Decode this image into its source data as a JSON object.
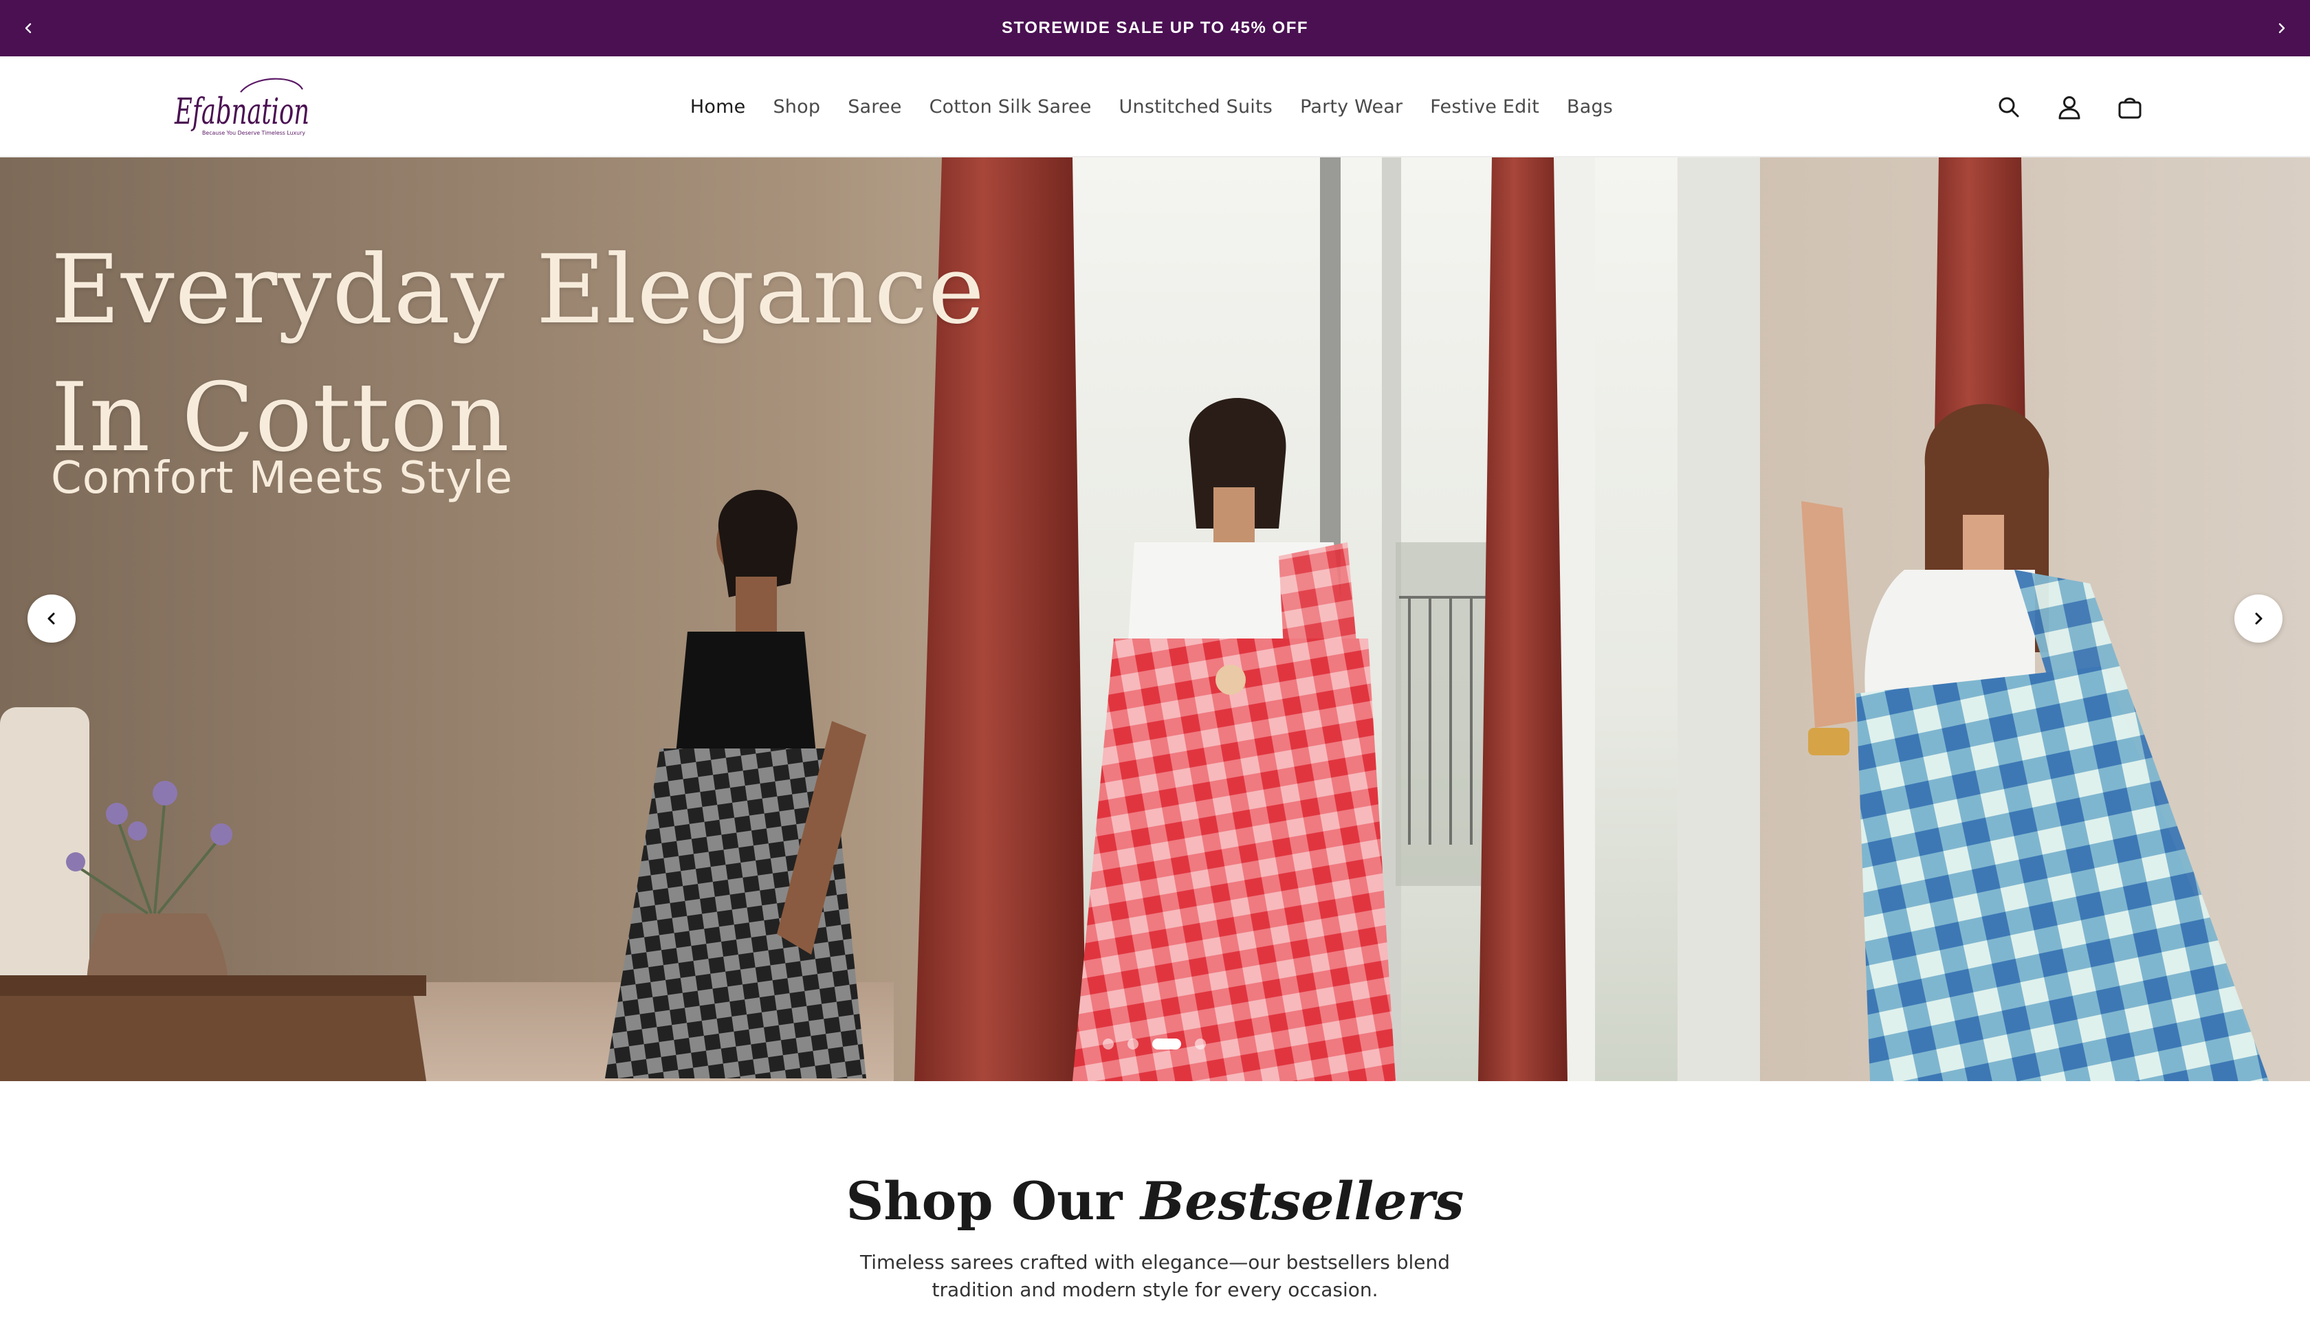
{
  "announcement": {
    "text": "STOREWIDE SALE UP TO 45% OFF",
    "prev_icon": "chevron-left-icon",
    "next_icon": "chevron-right-icon",
    "background_color": "#4a1052"
  },
  "header": {
    "logo": {
      "wordmark": "Efabnation",
      "tagline": "Because You Deserve Timeless Luxury"
    },
    "nav": [
      "Home",
      "Shop",
      "Saree",
      "Cotton Silk Saree",
      "Unstitched Suits",
      "Party Wear",
      "Festive Edit",
      "Bags"
    ],
    "active_nav": "Home",
    "icons": [
      "search-icon",
      "account-icon",
      "cart-icon"
    ]
  },
  "hero": {
    "title_line1": "Everyday Elegance",
    "title_line2": "In Cotton",
    "subtitle": "Comfort Meets Style",
    "slide_count": 4,
    "active_slide": 3,
    "prev_icon": "chevron-left-icon",
    "next_icon": "chevron-right-icon"
  },
  "bestsellers": {
    "title_regular": "Shop Our",
    "title_italic": "Bestsellers",
    "description": "Timeless sarees crafted with elegance—our bestsellers blend tradition and modern style for every occasion."
  },
  "colors": {
    "brand_purple": "#4a1052",
    "hero_text": "#f7ecdc"
  }
}
